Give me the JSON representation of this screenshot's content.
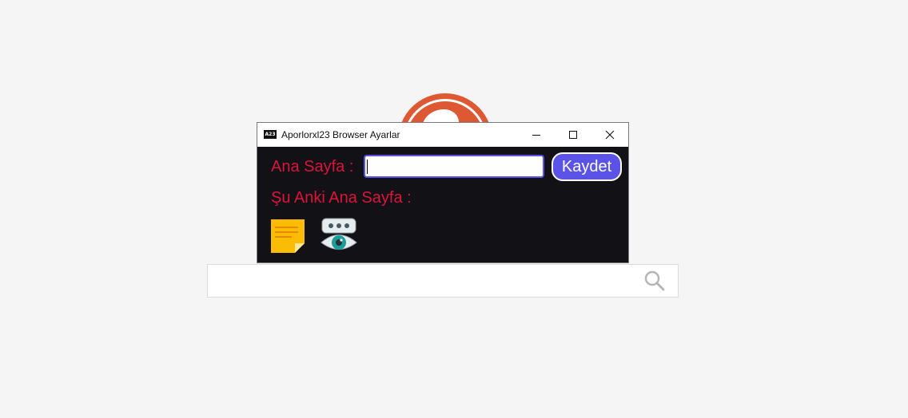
{
  "window": {
    "title": "Aporlorxl23 Browser Ayarlar",
    "app_icon_text": "A23",
    "controls": [
      "minimize",
      "maximize",
      "close"
    ]
  },
  "form": {
    "home_label": "Ana Sayfa :",
    "home_input_value": "",
    "save_label": "Kaydet",
    "current_home_label": "Şu Anki Ana Sayfa :"
  },
  "icons": {
    "notes": "sticky-note-icon",
    "view_passwords": "eye-password-icon",
    "search": "search-icon",
    "background_logo": "duck-logo-icon"
  },
  "colors": {
    "window_bg": "#121116",
    "label_text": "#dc143c",
    "accent": "#5b52e8",
    "background": "#f5f5f5",
    "logo": "#de5833"
  }
}
